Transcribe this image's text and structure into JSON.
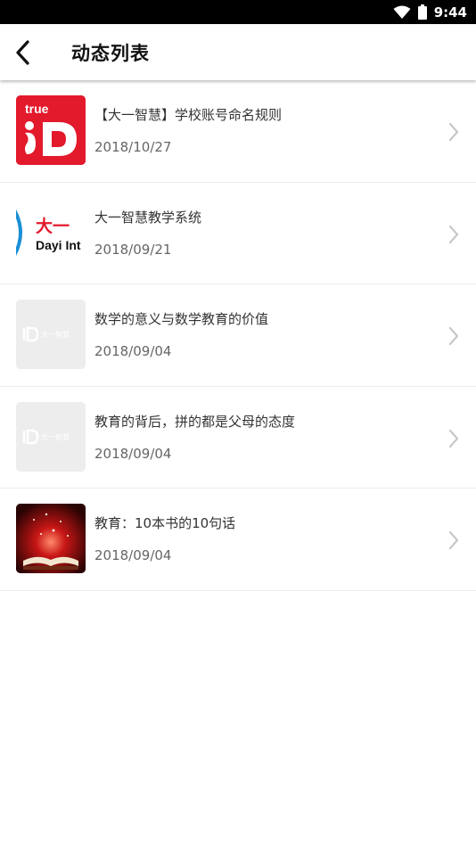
{
  "status": {
    "time": "9:44"
  },
  "header": {
    "title": "动态列表"
  },
  "icons": {
    "back": "back-arrow-icon",
    "chevron": "chevron-right-icon",
    "wifi": "wifi-icon",
    "battery": "battery-icon"
  },
  "thumbs": {
    "t0_top": "true",
    "t1_cn": "大一",
    "t1_en": "Dayi Int",
    "logo_cn": "大一智慧"
  },
  "items": [
    {
      "title": "【大一智慧】学校账号命名规则",
      "date": "2018/10/27",
      "thumb": "trueid-logo"
    },
    {
      "title": "大一智慧教学系统",
      "date": "2018/09/21",
      "thumb": "dayi-logo"
    },
    {
      "title": "数学的意义与数学教育的价值",
      "date": "2018/09/04",
      "thumb": "placeholder-logo"
    },
    {
      "title": "教育的背后，拼的都是父母的态度",
      "date": "2018/09/04",
      "thumb": "placeholder-logo"
    },
    {
      "title": "教育：10本书的10句话",
      "date": "2018/09/04",
      "thumb": "book-photo"
    }
  ],
  "colors": {
    "accent_red": "#e3192c",
    "text_primary": "#333333",
    "text_secondary": "#666666",
    "chevron": "#c7c7c7"
  }
}
